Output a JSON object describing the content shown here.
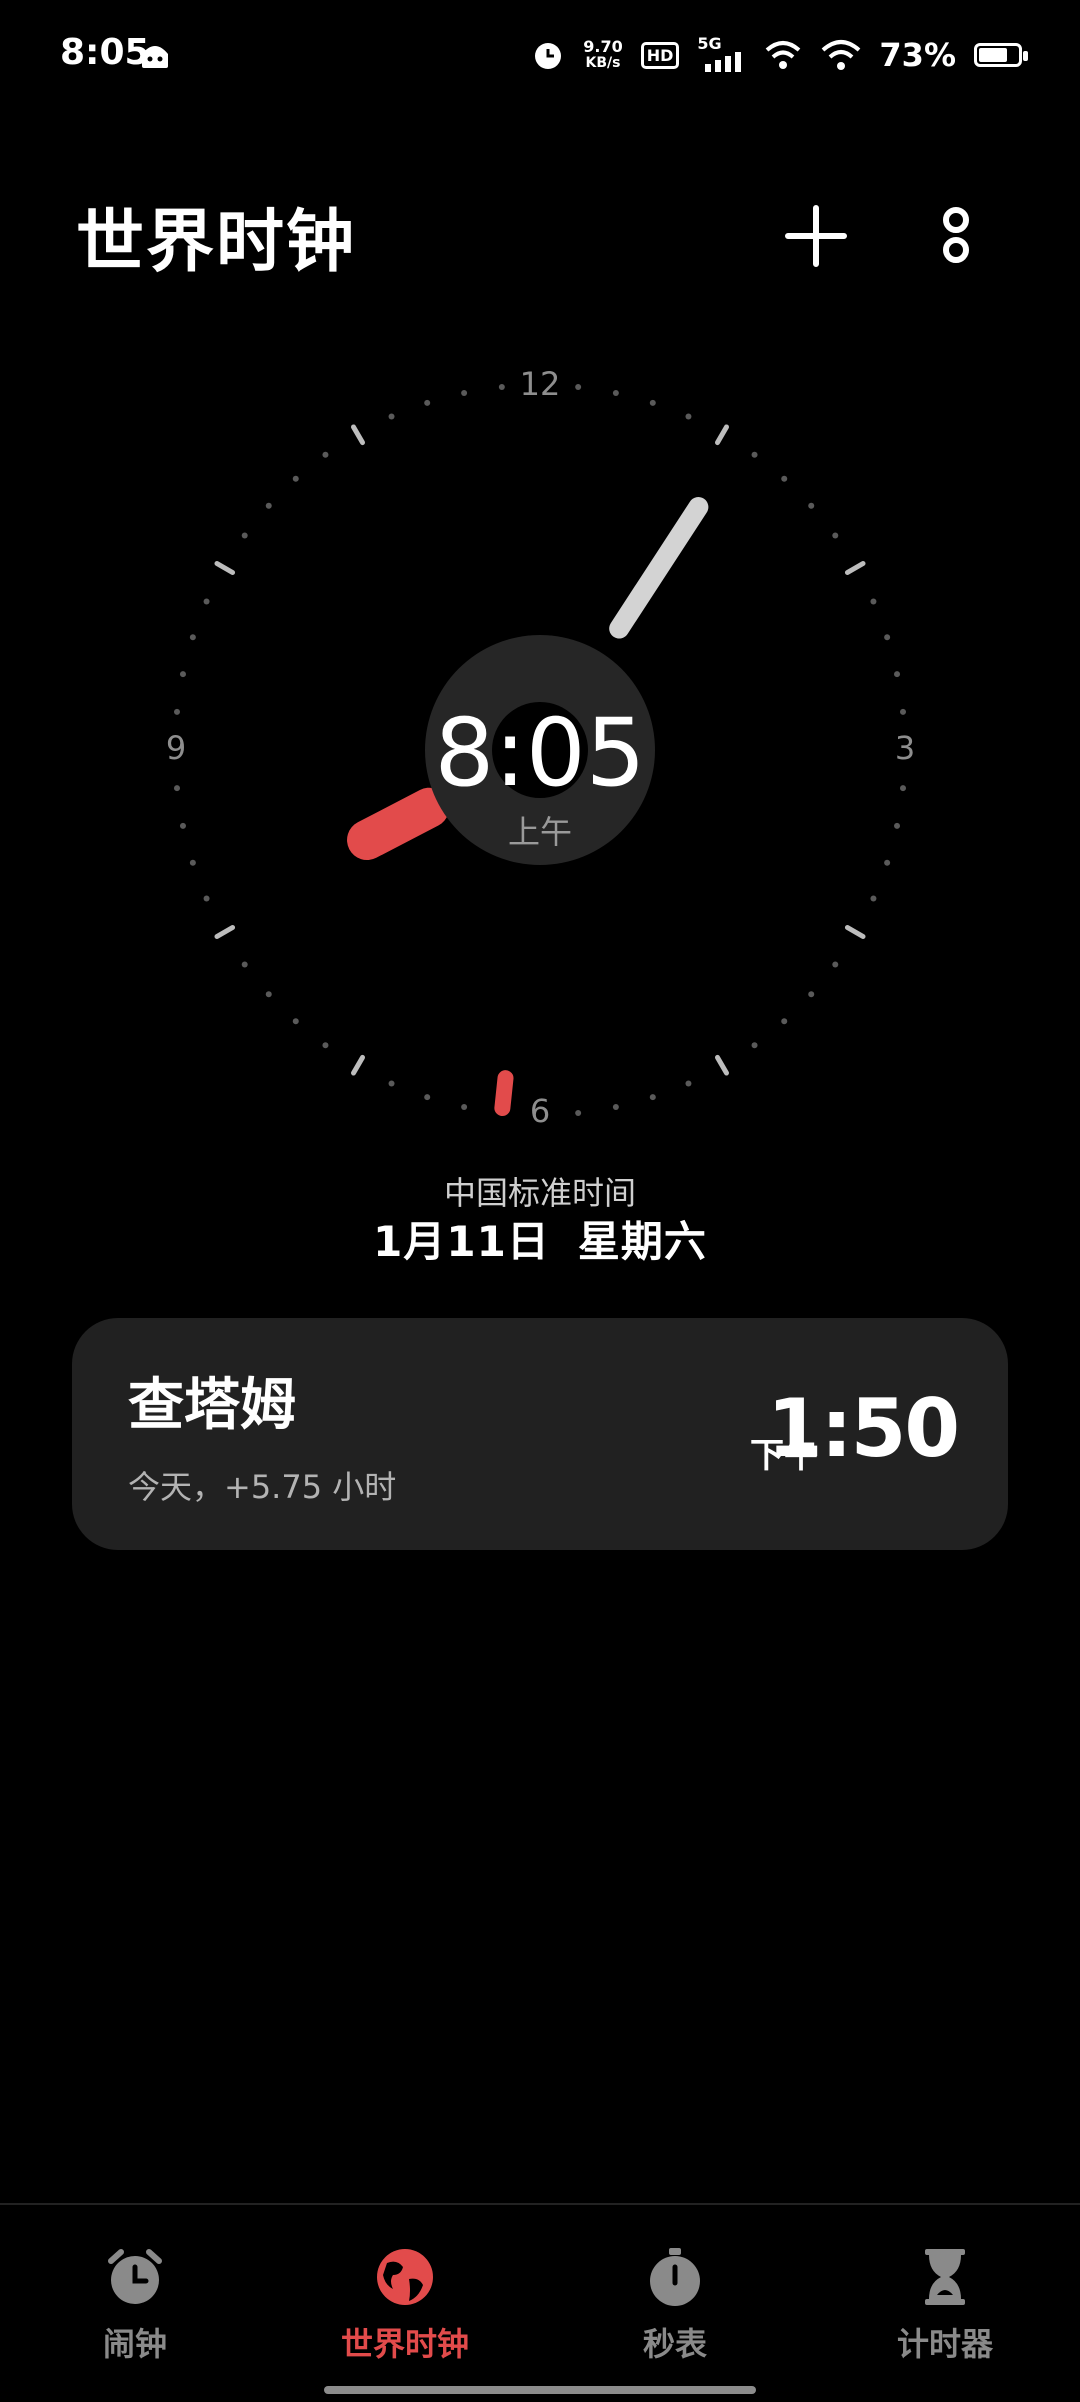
{
  "status_bar": {
    "time": "8:05",
    "net_speed_value": "9.70",
    "net_speed_unit": "KB/s",
    "hd_badge": "HD",
    "network": "5G",
    "battery_percent": "73%",
    "battery_level": 0.73
  },
  "header": {
    "title": "世界时钟",
    "add_icon": "plus-icon",
    "more_icon": "more-icon"
  },
  "clock": {
    "digital_time": "8:05",
    "ampm": "上午",
    "numeral_12": "12",
    "numeral_3": "3",
    "numeral_6": "6",
    "numeral_9": "9",
    "hour": 8,
    "minute": 5,
    "second": 31,
    "timezone_name": "中国标准时间",
    "date": "1月11日",
    "weekday": "星期六",
    "accent_color": "#e24b4b",
    "minute_hand_color": "#d3d3d3"
  },
  "cities": [
    {
      "name": "查塔姆",
      "offset": "今天，+5.75 小时",
      "ampm": "下午",
      "time": "1:50"
    }
  ],
  "nav": {
    "items": [
      {
        "label": "闹钟",
        "icon": "alarm-clock-icon",
        "active": false
      },
      {
        "label": "世界时钟",
        "icon": "globe-icon",
        "active": true
      },
      {
        "label": "秒表",
        "icon": "stopwatch-icon",
        "active": false
      },
      {
        "label": "计时器",
        "icon": "hourglass-icon",
        "active": false
      }
    ]
  }
}
